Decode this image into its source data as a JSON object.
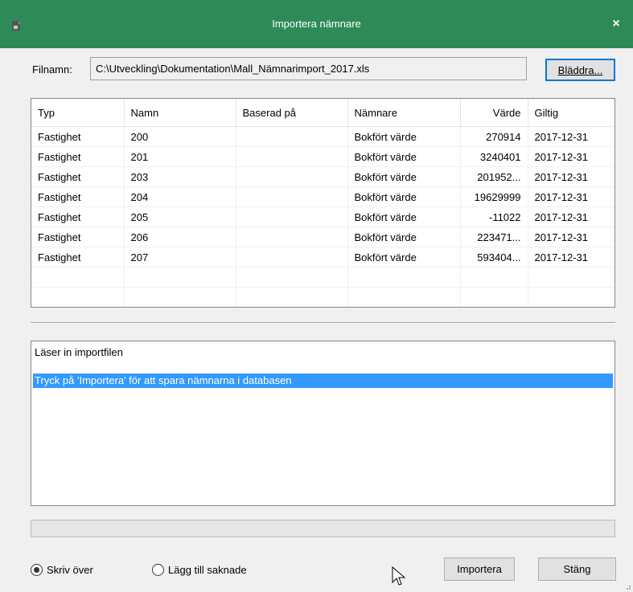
{
  "window": {
    "title": "Importera nämnare",
    "close_glyph": "×",
    "accent": "#2e8b57"
  },
  "file": {
    "label": "Filnamn:",
    "value": "C:\\Utveckling\\Dokumentation\\Mall_Nämnarimport_2017.xls",
    "browse_label": "Bläddra..."
  },
  "grid": {
    "columns": [
      "Typ",
      "Namn",
      "Baserad på",
      "Nämnare",
      "Värde",
      "Giltig"
    ],
    "rows": [
      [
        "Fastighet",
        "200",
        "",
        "Bokfört värde",
        "270914",
        "2017-12-31"
      ],
      [
        "Fastighet",
        "201",
        "",
        "Bokfört värde",
        "3240401",
        "2017-12-31"
      ],
      [
        "Fastighet",
        "203",
        "",
        "Bokfört värde",
        "201952...",
        "2017-12-31"
      ],
      [
        "Fastighet",
        "204",
        "",
        "Bokfört värde",
        "19629999",
        "2017-12-31"
      ],
      [
        "Fastighet",
        "205",
        "",
        "Bokfört värde",
        "-11022",
        "2017-12-31"
      ],
      [
        "Fastighet",
        "206",
        "",
        "Bokfört värde",
        "223471...",
        "2017-12-31"
      ],
      [
        "Fastighet",
        "207",
        "",
        "Bokfört värde",
        "593404...",
        "2017-12-31"
      ]
    ]
  },
  "log": {
    "lines": [
      "Läser in importfilen",
      "Tryck på 'Importera' för att spara nämnarna i databasen"
    ],
    "highlight_color": "#3399ff"
  },
  "options": {
    "overwrite_label": "Skriv över",
    "add_missing_label": "Lägg till saknade",
    "selected": "overwrite"
  },
  "buttons": {
    "import_label": "Importera",
    "close_label": "Stäng"
  },
  "icons": {
    "app": "app-icon",
    "close": "close-icon",
    "cursor": "mouse-cursor-icon",
    "grip": "resize-grip-icon"
  }
}
